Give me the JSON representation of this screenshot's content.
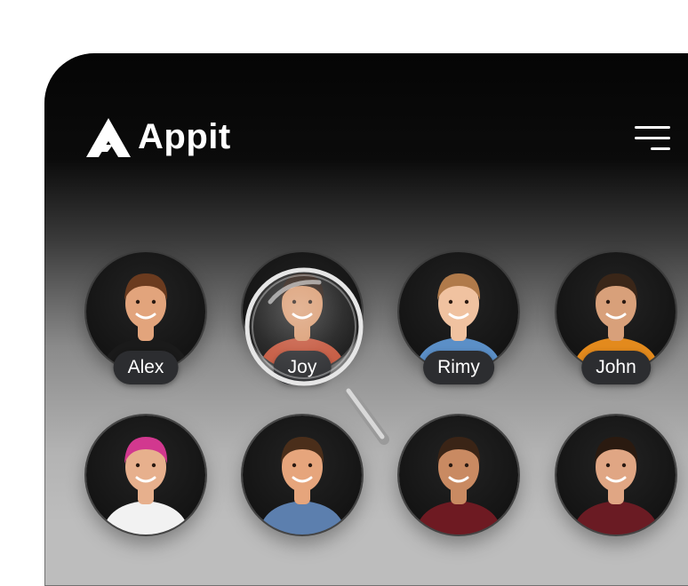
{
  "app": {
    "name": "Appit"
  },
  "icons": {
    "logo": "appit-logo-icon",
    "menu": "hamburger-menu-icon",
    "magnifier": "magnifying-glass-icon"
  },
  "colors": {
    "chip_bg": "#2c2d30",
    "avatar_bg": "#161616",
    "text": "#ffffff"
  },
  "contacts": [
    {
      "name": "Alex",
      "shirt": "#1a1a1a",
      "hair": "#6b3b1f",
      "skin": "#e2a47c"
    },
    {
      "name": "Joy",
      "shirt": "#c4553b",
      "hair": "#2a1a12",
      "skin": "#d9996e"
    },
    {
      "name": "Rimy",
      "shirt": "#5b8fc7",
      "hair": "#b07a4a",
      "skin": "#f0c2a0"
    },
    {
      "name": "John",
      "shirt": "#e38a1d",
      "hair": "#3a2618",
      "skin": "#d8a07a"
    },
    {
      "name": "",
      "shirt": "#f2f2f2",
      "hair": "#d2388f",
      "skin": "#e7b08d"
    },
    {
      "name": "",
      "shirt": "#5c7fae",
      "hair": "#4a2e1a",
      "skin": "#e6a57c"
    },
    {
      "name": "",
      "shirt": "#6e1a22",
      "hair": "#3a2416",
      "skin": "#c98a62"
    },
    {
      "name": "",
      "shirt": "#6a1b23",
      "hair": "#2a1a10",
      "skin": "#e0a684"
    }
  ]
}
